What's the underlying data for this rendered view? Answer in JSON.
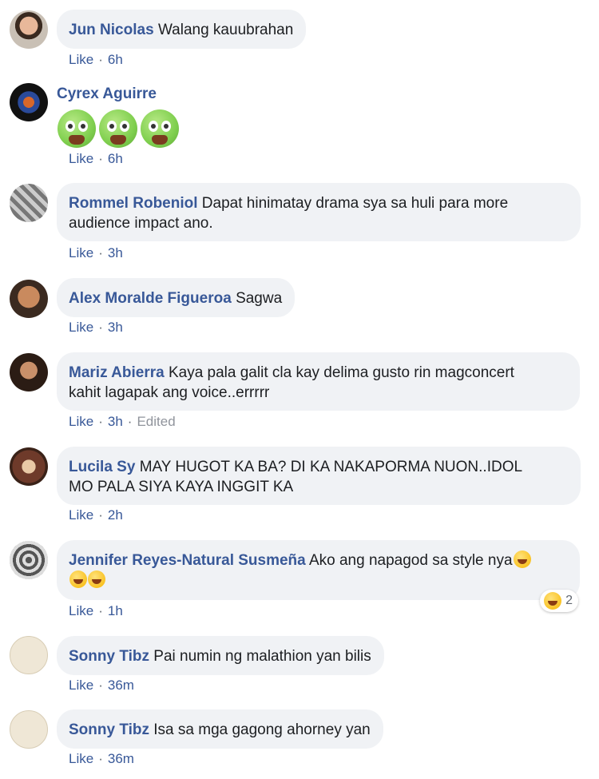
{
  "comments": [
    {
      "author": "Jun Nicolas",
      "text": "Walang kauubrahan",
      "like": "Like",
      "time": "6h"
    },
    {
      "author": "Cyrex Aguirre",
      "emoji": [
        "nauseated-face-icon",
        "nauseated-face-icon",
        "nauseated-face-icon"
      ],
      "like": "Like",
      "time": "6h"
    },
    {
      "author": "Rommel Robeniol",
      "text": "Dapat hinimatay drama sya sa huli para more",
      "text2": "audience impact ano.",
      "like": "Like",
      "time": "3h"
    },
    {
      "author": "Alex Moralde Figueroa",
      "text": "Sagwa",
      "like": "Like",
      "time": "3h"
    },
    {
      "author": "Mariz Abierra",
      "text": "Kaya pala galit cla kay delima gusto rin magconcert",
      "text2": "kahit lagapak ang voice..errrrr",
      "like": "Like",
      "time": "3h",
      "edited": "Edited"
    },
    {
      "author": "Lucila Sy",
      "text": "MAY HUGOT KA BA? DI KA NAKAPORMA NUON..IDOL",
      "text2": "MO PALA SIYA KAYA INGGIT KA",
      "like": "Like",
      "time": "2h"
    },
    {
      "author": "Jennifer Reyes-Natural Susmeña",
      "text": "Ako ang napagod sa style nya",
      "like": "Like",
      "time": "1h",
      "reaction_count": "2"
    },
    {
      "author": "Sonny Tibz",
      "text": "Pai numin ng malathion yan bilis",
      "like": "Like",
      "time": "36m"
    },
    {
      "author": "Sonny Tibz",
      "text": "Isa sa mga gagong ahorney yan",
      "like": "Like",
      "time": "36m"
    }
  ],
  "colors": {
    "author": "#385898",
    "bubble": "#f0f2f5",
    "text": "#1c1e21",
    "meta_gray": "#90949c"
  }
}
